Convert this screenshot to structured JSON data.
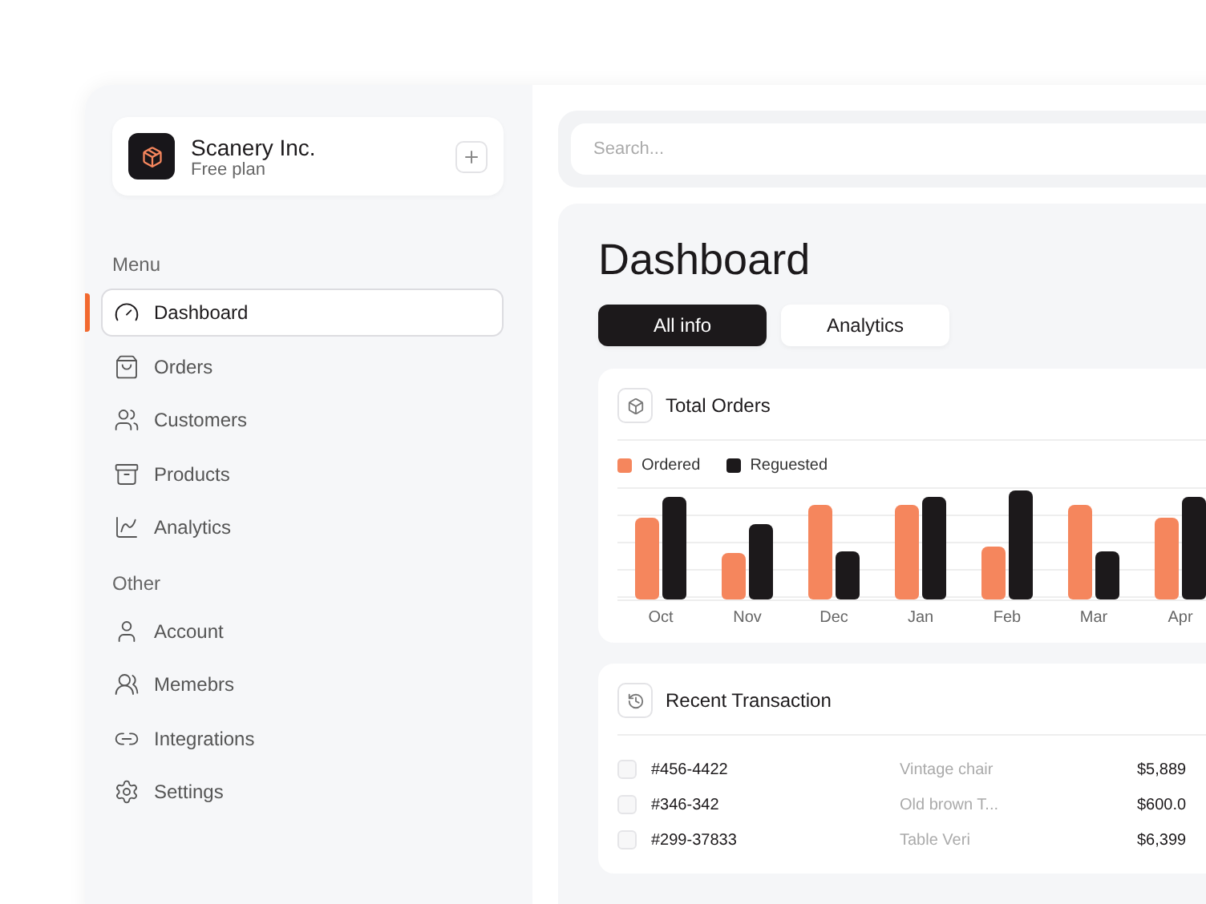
{
  "company": {
    "name": "Scanery Inc.",
    "plan": "Free plan"
  },
  "sidebar": {
    "sections": [
      {
        "title": "Menu",
        "items": [
          {
            "label": "Dashboard",
            "selected": true
          },
          {
            "label": "Orders",
            "selected": false
          },
          {
            "label": "Customers",
            "selected": false
          },
          {
            "label": "Products",
            "selected": false
          },
          {
            "label": "Analytics",
            "selected": false
          }
        ]
      },
      {
        "title": "Other",
        "items": [
          {
            "label": "Account",
            "selected": false
          },
          {
            "label": "Memebrs",
            "selected": false
          },
          {
            "label": "Integrations",
            "selected": false
          },
          {
            "label": "Settings",
            "selected": false
          }
        ]
      }
    ]
  },
  "search": {
    "placeholder": "Search..."
  },
  "page_title": "Dashboard",
  "tabs": [
    {
      "label": "All info",
      "selected": true
    },
    {
      "label": "Analytics",
      "selected": false
    }
  ],
  "orders_card": {
    "title": "Total Orders",
    "legend": [
      {
        "label": "Ordered",
        "color": "#f5865d"
      },
      {
        "label": "Reguested",
        "color": "#1c191b"
      }
    ],
    "months": [
      "Oct",
      "Nov",
      "Dec",
      "Jan",
      "Feb",
      "Mar",
      "Apr"
    ]
  },
  "transactions": {
    "title": "Recent Transaction",
    "rows": [
      {
        "id": "#456-4422",
        "product": "Vintage chair",
        "amount": "$5,889",
        "checked": false
      },
      {
        "id": "#346-342",
        "product": "Old brown T...",
        "amount": "$600.0",
        "checked": false
      },
      {
        "id": "#299-37833",
        "product": "Table Veri",
        "amount": "$6,399",
        "checked": false
      }
    ]
  }
}
